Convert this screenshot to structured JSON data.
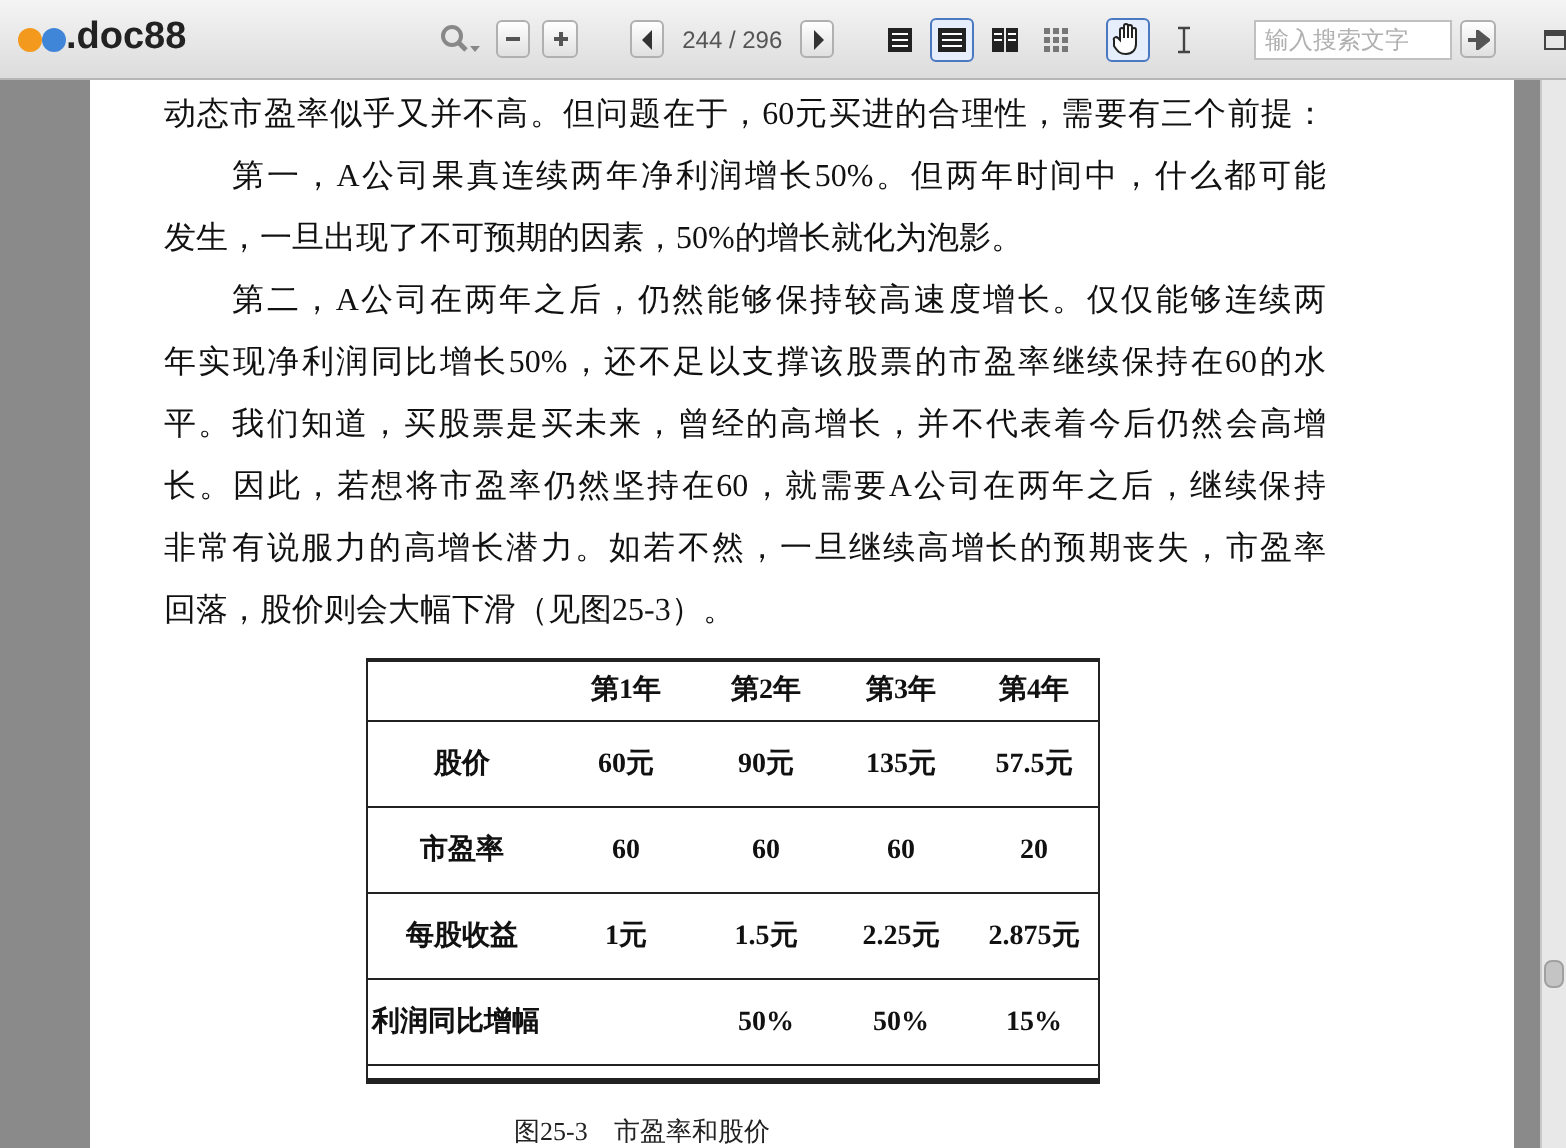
{
  "toolbar": {
    "logo": ".doc88",
    "page_indicator": "244 / 296",
    "search": {
      "placeholder": "输入搜索文字"
    },
    "view_modes": [
      {
        "selected": false
      },
      {
        "selected": true
      },
      {
        "selected": false
      },
      {
        "selected": false
      }
    ],
    "tools": [
      {
        "kind": "hand",
        "selected": true
      },
      {
        "kind": "text",
        "selected": false
      }
    ]
  },
  "document": {
    "paragraphs": [
      {
        "indent": false,
        "lines": [
          "动态市盈率似乎又并不高。但问题在于，60元买进的合理性，需要有三个前提："
        ]
      },
      {
        "indent": true,
        "lines": [
          "第一，A公司果真连续两年净利润增长50%。但两年时间中，什么都可能",
          "发生，一旦出现了不可预期的因素，50%的增长就化为泡影。"
        ]
      },
      {
        "indent": true,
        "lines": [
          "第二，A公司在两年之后，仍然能够保持较高速度增长。仅仅能够连续两",
          "年实现净利润同比增长50%，还不足以支撑该股票的市盈率继续保持在60的水",
          "平。我们知道，买股票是买未来，曾经的高增长，并不代表着今后仍然会高增",
          "长。因此，若想将市盈率仍然坚持在60，就需要A公司在两年之后，继续保持",
          "非常有说服力的高增长潜力。如若不然，一旦继续高增长的预期丧失，市盈率",
          "回落，股价则会大幅下滑（见图25-3）。"
        ]
      }
    ],
    "table": {
      "columns": [
        "第1年",
        "第2年",
        "第3年",
        "第4年"
      ],
      "rows": [
        {
          "label": "股价",
          "cells": [
            "60元",
            "90元",
            "135元",
            "57.5元"
          ]
        },
        {
          "label": "市盈率",
          "cells": [
            "60",
            "60",
            "60",
            "20"
          ]
        },
        {
          "label": "每股收益",
          "cells": [
            "1元",
            "1.5元",
            "2.25元",
            "2.875元"
          ]
        },
        {
          "label": "利润同比增幅",
          "cells": [
            "",
            "50%",
            "50%",
            "15%"
          ]
        }
      ]
    },
    "caption": "图25-3　市盈率和股价"
  }
}
